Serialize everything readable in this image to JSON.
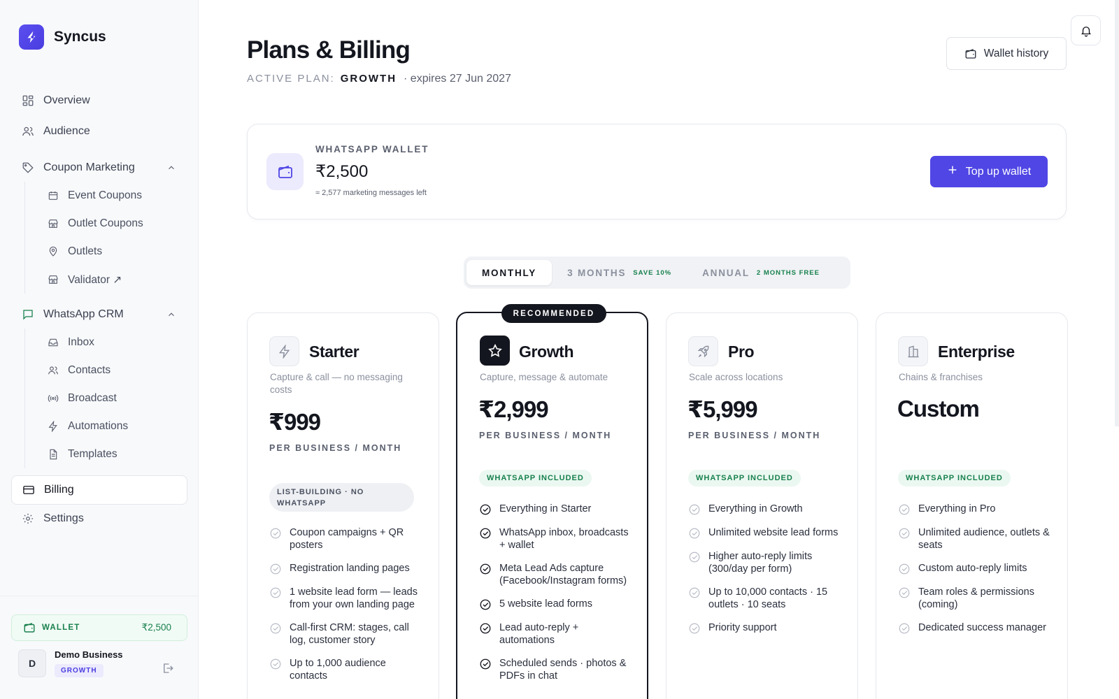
{
  "brand": {
    "name": "Syncus"
  },
  "nav": {
    "overview": "Overview",
    "audience": "Audience",
    "coupon_marketing": "Coupon Marketing",
    "coupon_sub": [
      "Event Coupons",
      "Outlet Coupons",
      "Outlets",
      "Validator ↗"
    ],
    "whatsapp_crm": "WhatsApp CRM",
    "whatsapp_sub": [
      "Inbox",
      "Contacts",
      "Broadcast",
      "Automations",
      "Templates"
    ],
    "billing": "Billing",
    "settings": "Settings"
  },
  "footer": {
    "wallet_label": "WALLET",
    "wallet_amount": "₹2,500",
    "avatar_initial": "D",
    "user_name": "Demo Business",
    "user_plan": "GROWTH"
  },
  "header": {
    "title": "Plans & Billing",
    "active_plan_label": "ACTIVE PLAN:",
    "active_plan_value": "GROWTH",
    "expires": "· expires 27 Jun 2027",
    "wallet_history": "Wallet history"
  },
  "wallet": {
    "label": "WHATSAPP WALLET",
    "amount": "₹2,500",
    "sub": "≈ 2,577 marketing messages left",
    "topup": "Top up wallet"
  },
  "billing_toggle": {
    "monthly": "MONTHLY",
    "three_months": "3 MONTHS",
    "three_months_save": "SAVE 10%",
    "annual": "ANNUAL",
    "annual_save": "2 MONTHS FREE"
  },
  "plans": [
    {
      "name": "Starter",
      "desc": "Capture & call — no messaging costs",
      "price": "₹999",
      "per": "PER BUSINESS / MONTH",
      "tag": "LIST-BUILDING · NO WHATSAPP",
      "features": [
        "Coupon campaigns + QR posters",
        "Registration landing pages",
        "1 website lead form — leads from your own landing page",
        "Call-first CRM: stages, call log, customer story",
        "Up to 1,000 audience contacts"
      ]
    },
    {
      "name": "Growth",
      "badge": "RECOMMENDED",
      "desc": "Capture, message & automate",
      "price": "₹2,999",
      "per": "PER BUSINESS / MONTH",
      "tag": "WHATSAPP INCLUDED",
      "features": [
        "Everything in Starter",
        "WhatsApp inbox, broadcasts + wallet",
        "Meta Lead Ads capture (Facebook/Instagram forms)",
        "5 website lead forms",
        "Lead auto-reply + automations",
        "Scheduled sends · photos & PDFs in chat"
      ]
    },
    {
      "name": "Pro",
      "desc": "Scale across locations",
      "price": "₹5,999",
      "per": "PER BUSINESS / MONTH",
      "tag": "WHATSAPP INCLUDED",
      "features": [
        "Everything in Growth",
        "Unlimited website lead forms",
        "Higher auto-reply limits (300/day per form)",
        "Up to 10,000 contacts · 15 outlets · 10 seats",
        "Priority support"
      ]
    },
    {
      "name": "Enterprise",
      "desc": "Chains & franchises",
      "price": "Custom",
      "tag": "WHATSAPP INCLUDED",
      "features": [
        "Everything in Pro",
        "Unlimited audience, outlets & seats",
        "Custom auto-reply limits",
        "Team roles & permissions (coming)",
        "Dedicated success manager"
      ]
    }
  ]
}
